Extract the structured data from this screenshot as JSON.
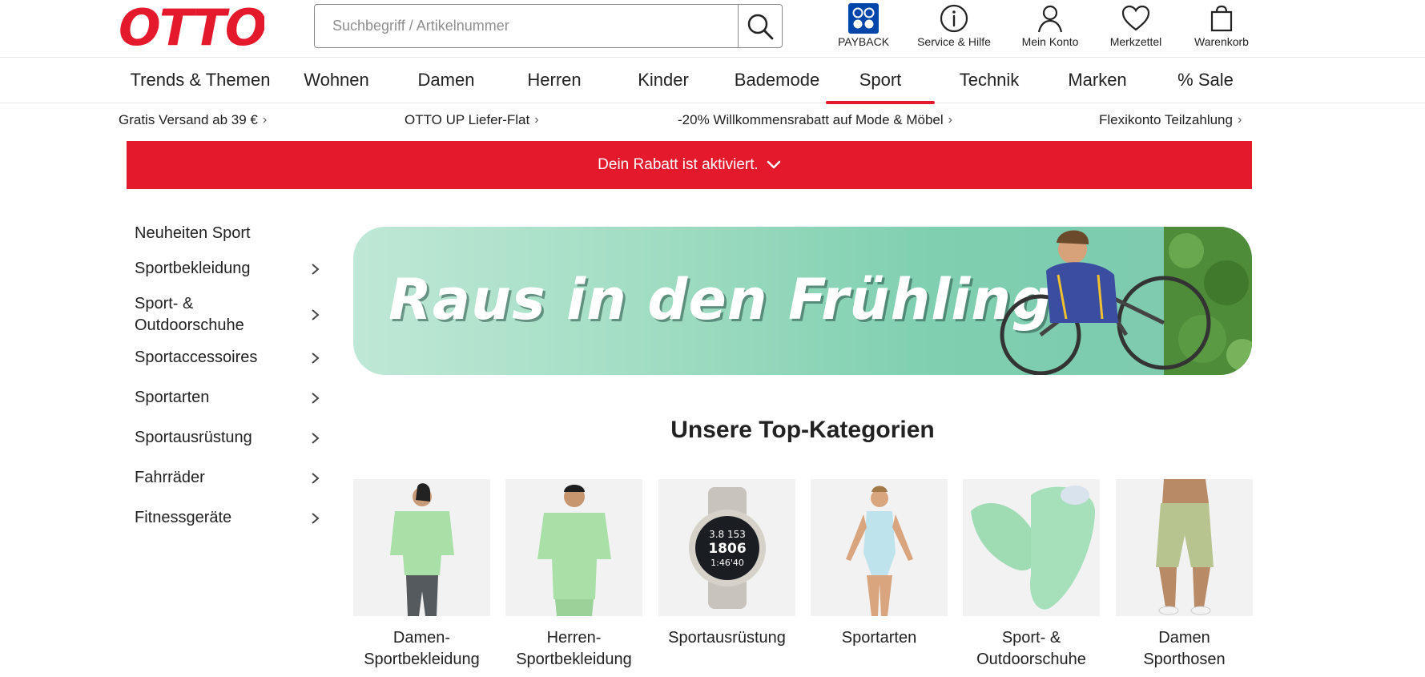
{
  "brand": {
    "logo_text": "OTTO",
    "accent": "#e4192c"
  },
  "search": {
    "placeholder": "Suchbegriff / Artikelnummer",
    "icon": "search-icon"
  },
  "header_icons": [
    {
      "label": "PAYBACK",
      "icon": "payback-icon"
    },
    {
      "label": "Service & Hilfe",
      "icon": "info-icon"
    },
    {
      "label": "Mein Konto",
      "icon": "user-icon"
    },
    {
      "label": "Merkzettel",
      "icon": "heart-icon"
    },
    {
      "label": "Warenkorb",
      "icon": "cart-icon"
    }
  ],
  "main_nav": [
    {
      "label": "Trends & Themen"
    },
    {
      "label": "Wohnen"
    },
    {
      "label": "Damen"
    },
    {
      "label": "Herren"
    },
    {
      "label": "Kinder"
    },
    {
      "label": "Bademode"
    },
    {
      "label": "Sport",
      "active": true
    },
    {
      "label": "Technik"
    },
    {
      "label": "Marken"
    },
    {
      "label": "% Sale"
    }
  ],
  "usp_bar": [
    {
      "label": "Gratis Versand ab 39 €"
    },
    {
      "label": "OTTO UP Liefer-Flat"
    },
    {
      "label": "-20% Willkommensrabatt auf Mode & Möbel"
    },
    {
      "label": "Flexikonto Teilzahlung"
    }
  ],
  "discount_banner": {
    "label": "Dein Rabatt ist aktiviert."
  },
  "sidebar": {
    "items": [
      {
        "label": "Neuheiten Sport",
        "has_children": false
      },
      {
        "label": "Sportbekleidung",
        "has_children": true
      },
      {
        "label": "Sport- & Outdoorschuhe",
        "has_children": true
      },
      {
        "label": "Sportaccessoires",
        "has_children": true
      },
      {
        "label": "Sportarten",
        "has_children": true
      },
      {
        "label": "Sportausrüstung",
        "has_children": true
      },
      {
        "label": "Fahrräder",
        "has_children": true
      },
      {
        "label": "Fitnessgeräte",
        "has_children": true
      }
    ]
  },
  "hero": {
    "title": "Raus in den Frühling"
  },
  "top_categories": {
    "title": "Unsere Top-Kategorien",
    "items": [
      {
        "label": "Damen-Sportbekleidung"
      },
      {
        "label": "Herren-Sportbekleidung"
      },
      {
        "label": "Sportausrüstung",
        "watch_readout": [
          "3.8 153",
          "1806",
          "1:46'40"
        ]
      },
      {
        "label": "Sportarten"
      },
      {
        "label": "Sport- & Outdoorschuhe"
      },
      {
        "label": "Damen Sporthosen"
      }
    ]
  }
}
